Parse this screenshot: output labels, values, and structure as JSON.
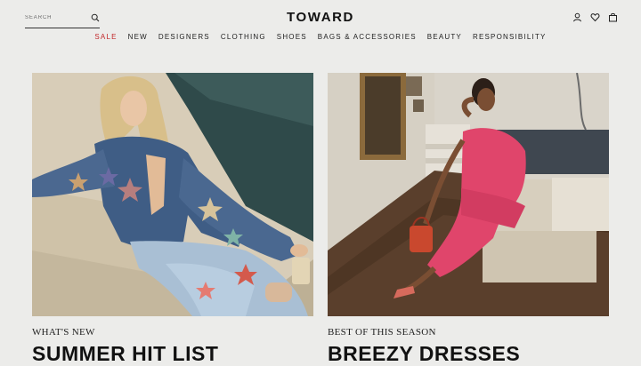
{
  "header": {
    "search": {
      "placeholder": "SEARCH",
      "value": ""
    },
    "logo": "TOWARD",
    "icons": [
      "user-icon",
      "heart-icon",
      "bag-icon"
    ]
  },
  "nav": {
    "items": [
      {
        "label": "SALE",
        "highlight": true
      },
      {
        "label": "NEW"
      },
      {
        "label": "DESIGNERS"
      },
      {
        "label": "CLOTHING"
      },
      {
        "label": "SHOES"
      },
      {
        "label": "BAGS & ACCESSORIES"
      },
      {
        "label": "BEAUTY"
      },
      {
        "label": "RESPONSIBILITY"
      }
    ]
  },
  "hero": {
    "cards": [
      {
        "eyebrow": "WHAT'S NEW",
        "title": "SUMMER HIT LIST"
      },
      {
        "eyebrow": "BEST OF THIS SEASON",
        "title": "BREEZY DRESSES"
      }
    ]
  },
  "colors": {
    "sale": "#c2282b",
    "background": "#ececea",
    "text": "#1a1a1a"
  }
}
